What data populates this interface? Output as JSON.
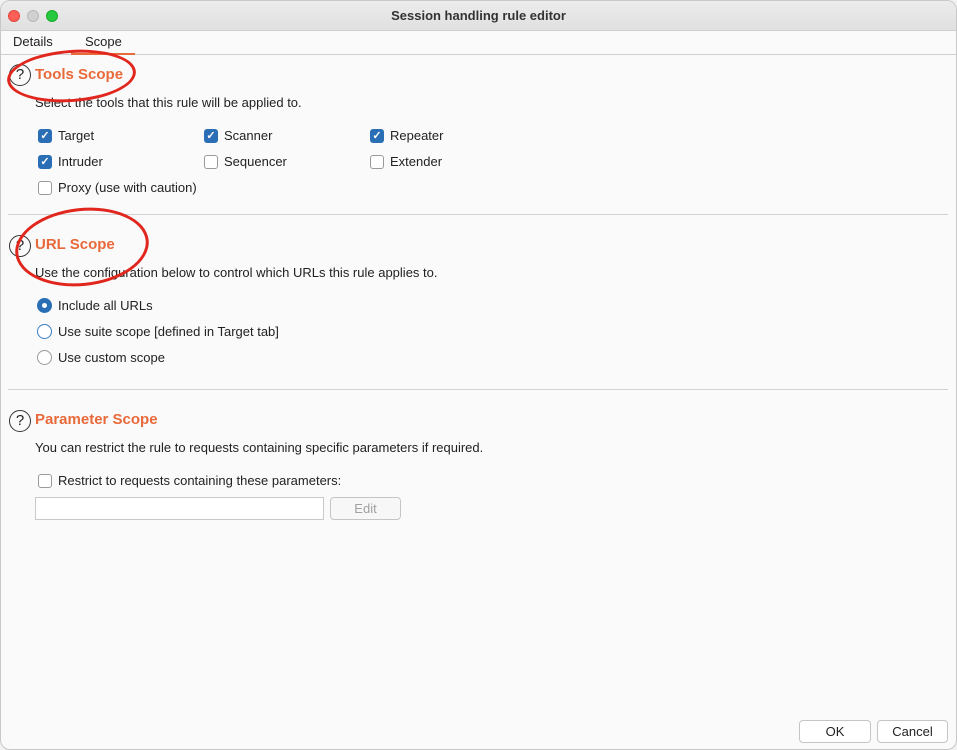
{
  "window": {
    "title": "Session handling rule editor"
  },
  "tabs": [
    {
      "label": "Details"
    },
    {
      "label": "Scope"
    }
  ],
  "tools_scope": {
    "title": "Tools Scope",
    "description": "Select the tools that this rule will be applied to.",
    "tools": [
      {
        "label": "Target",
        "checked": true
      },
      {
        "label": "Scanner",
        "checked": true
      },
      {
        "label": "Repeater",
        "checked": true
      },
      {
        "label": "Intruder",
        "checked": true
      },
      {
        "label": "Sequencer",
        "checked": false
      },
      {
        "label": "Extender",
        "checked": false
      },
      {
        "label": "Proxy (use with caution)",
        "checked": false
      }
    ]
  },
  "url_scope": {
    "title": "URL Scope",
    "description": "Use the configuration below to control which URLs this rule applies to.",
    "options": [
      {
        "label": "Include all URLs",
        "selected": true
      },
      {
        "label": "Use suite scope [defined in Target tab]",
        "selected": false
      },
      {
        "label": "Use custom scope",
        "selected": false
      }
    ]
  },
  "parameter_scope": {
    "title": "Parameter Scope",
    "description": "You can restrict the rule to requests containing specific parameters if required.",
    "restrict_label": "Restrict to requests containing these parameters:",
    "restrict_checked": false,
    "parameters_value": "",
    "edit_label": "Edit"
  },
  "footer": {
    "ok_label": "OK",
    "cancel_label": "Cancel"
  },
  "colors": {
    "accent": "#e8693a",
    "checkbox": "#2a6fb5",
    "annotation": "#e0261d"
  }
}
